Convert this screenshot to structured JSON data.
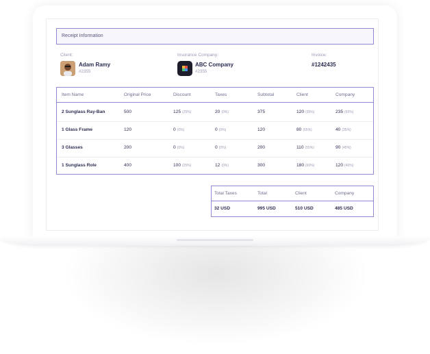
{
  "receipt": {
    "title": "Receipt Information"
  },
  "client": {
    "label": "Client:",
    "name": "Adam Ramy",
    "id": "#2355"
  },
  "insurance": {
    "label": "Insurance Company:",
    "name": "ABC Company",
    "id": "#2355"
  },
  "invoice": {
    "label": "Invoice:",
    "number": "#1242435"
  },
  "items_table": {
    "headers": [
      "Item Name",
      "Original Price",
      "Discount",
      "Taxes",
      "Subtotal",
      "Client",
      "Company"
    ],
    "rows": [
      {
        "item": "2 Sunglass Ray-Ban",
        "price": "500",
        "discount": "125",
        "discount_pct": "(25%)",
        "taxes": "20",
        "taxes_pct": "(0%)",
        "subtotal": "375",
        "client": "120",
        "client_pct": "(35%)",
        "company": "235",
        "company_pct": "(65%)"
      },
      {
        "item": "1 Glass Frame",
        "price": "120",
        "discount": "0",
        "discount_pct": "(0%)",
        "taxes": "0",
        "taxes_pct": "(0%)",
        "subtotal": "120",
        "client": "80",
        "client_pct": "(65%)",
        "company": "40",
        "company_pct": "(35%)"
      },
      {
        "item": "3 Glasses",
        "price": "200",
        "discount": "0",
        "discount_pct": "(0%)",
        "taxes": "0",
        "taxes_pct": "(0%)",
        "subtotal": "200",
        "client": "110",
        "client_pct": "(55%)",
        "company": "90",
        "company_pct": "(45%)"
      },
      {
        "item": "1 Sunglass Role",
        "price": "400",
        "discount": "100",
        "discount_pct": "(25%)",
        "taxes": "12",
        "taxes_pct": "(0%)",
        "subtotal": "300",
        "client": "180",
        "client_pct": "(60%)",
        "company": "120",
        "company_pct": "(40%)"
      }
    ]
  },
  "totals": {
    "headers": [
      "Total Taxes",
      "Total",
      "Client",
      "Company"
    ],
    "values": [
      "32 USD",
      "995 USD",
      "510 USD",
      "485 USD"
    ]
  },
  "colors": {
    "accent_border": "#8e8ad1",
    "header_bg": "#f7f6fd",
    "text": "#2c2d52"
  }
}
